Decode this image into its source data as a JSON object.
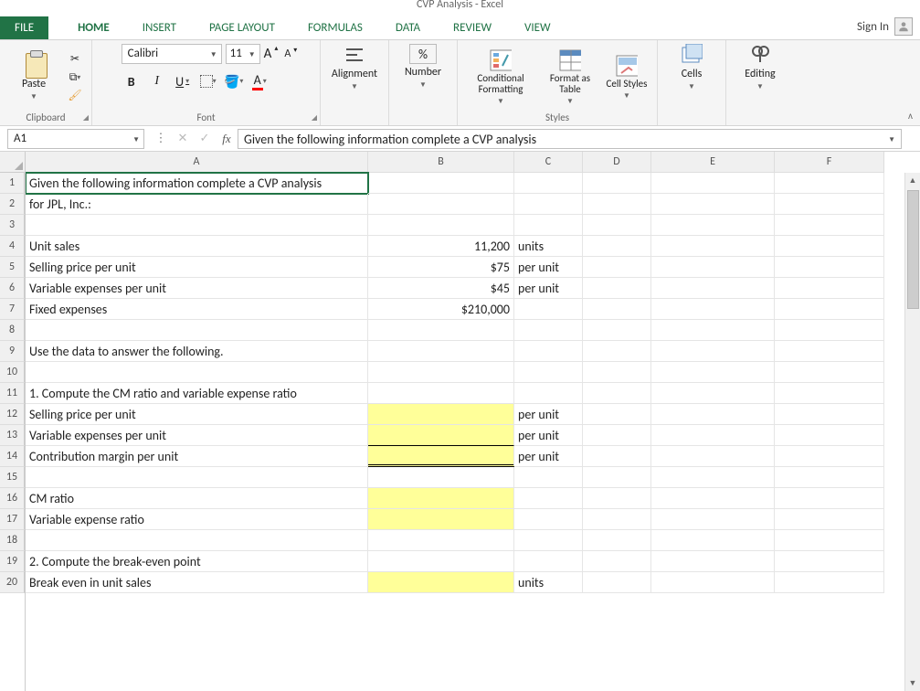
{
  "title": "CVP Analysis - Excel",
  "tabs": {
    "file": "FILE",
    "home": "HOME",
    "insert": "INSERT",
    "page_layout": "PAGE LAYOUT",
    "formulas": "FORMULAS",
    "data": "DATA",
    "review": "REVIEW",
    "view": "VIEW"
  },
  "active_tab": "HOME",
  "signin": "Sign In",
  "ribbon": {
    "clipboard": {
      "label": "Clipboard",
      "paste": "Paste"
    },
    "font": {
      "label": "Font",
      "name": "Calibri",
      "size": "11"
    },
    "alignment": {
      "label": "Alignment"
    },
    "number": {
      "label": "Number",
      "pct": "%"
    },
    "styles": {
      "label": "Styles",
      "cond": "Conditional Formatting",
      "table": "Format as Table",
      "cell": "Cell Styles"
    },
    "cells": {
      "label": "Cells"
    },
    "editing": {
      "label": "Editing"
    }
  },
  "name_box": "A1",
  "formula_bar": "Given the following information complete a CVP analysis",
  "column_widths": {
    "A": 375,
    "B": 160,
    "C": 75,
    "D": 75,
    "E": 135,
    "F": 120
  },
  "columns": [
    "A",
    "B",
    "C",
    "D",
    "E",
    "F"
  ],
  "rows": [
    {
      "n": 1,
      "A": "Given the following information complete a CVP analysis",
      "sel": true
    },
    {
      "n": 2,
      "A": "for JPL, Inc.:"
    },
    {
      "n": 3,
      "A": ""
    },
    {
      "n": 4,
      "A": "Unit sales",
      "B": "11,200",
      "Br": true,
      "C": "units"
    },
    {
      "n": 5,
      "A": "Selling price per unit",
      "B": "$75",
      "Br": true,
      "C": "per unit"
    },
    {
      "n": 6,
      "A": "Variable expenses per unit",
      "B": "$45",
      "Br": true,
      "C": "per unit"
    },
    {
      "n": 7,
      "A": "Fixed expenses",
      "B": "$210,000",
      "Br": true
    },
    {
      "n": 8,
      "A": ""
    },
    {
      "n": 9,
      "A": "Use the data to answer the following."
    },
    {
      "n": 10,
      "A": ""
    },
    {
      "n": 11,
      "A": "1. Compute the CM ratio and variable expense ratio"
    },
    {
      "n": 12,
      "A": "Selling price per unit",
      "Bhl": true,
      "C": "per unit"
    },
    {
      "n": 13,
      "A": "Variable expenses per unit",
      "Bhl": true,
      "Bul": true,
      "C": "per unit"
    },
    {
      "n": 14,
      "A": "Contribution margin per unit",
      "Bhl": true,
      "Bdbl": true,
      "C": "per unit"
    },
    {
      "n": 15,
      "A": ""
    },
    {
      "n": 16,
      "A": "CM ratio",
      "Bhl": true
    },
    {
      "n": 17,
      "A": "Variable expense ratio",
      "Bhl": true
    },
    {
      "n": 18,
      "A": ""
    },
    {
      "n": 19,
      "A": "2. Compute the break-even point"
    },
    {
      "n": 20,
      "A": "Break even in unit sales",
      "Bhl": true,
      "C": "units"
    }
  ]
}
